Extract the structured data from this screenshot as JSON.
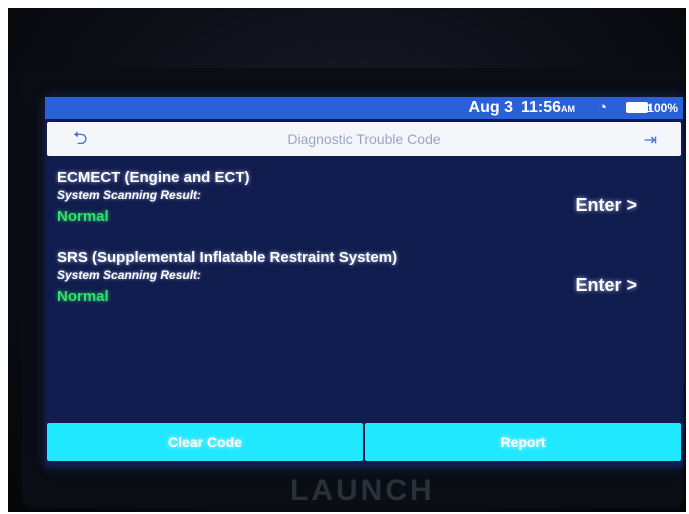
{
  "statusbar": {
    "date": "Aug 3",
    "time": "11:56",
    "ampm": "AM",
    "battery": "100%"
  },
  "header": {
    "title": "Diagnostic Trouble Code"
  },
  "systems": [
    {
      "name": "ECMECT (Engine and ECT)",
      "label": "System Scanning Result:",
      "status": "Normal",
      "enter": "Enter >"
    },
    {
      "name": "SRS (Supplemental Inflatable Restraint System)",
      "label": "System Scanning Result:",
      "status": "Normal",
      "enter": "Enter >"
    }
  ],
  "actions": {
    "clear_code": "Clear Code",
    "report": "Report"
  },
  "device": {
    "brand": "LAUNCH"
  },
  "colors": {
    "screen_bg": "#101b4e",
    "statusbar": "#2a61d9",
    "button": "#20e8ff",
    "status_ok": "#34e06a"
  }
}
